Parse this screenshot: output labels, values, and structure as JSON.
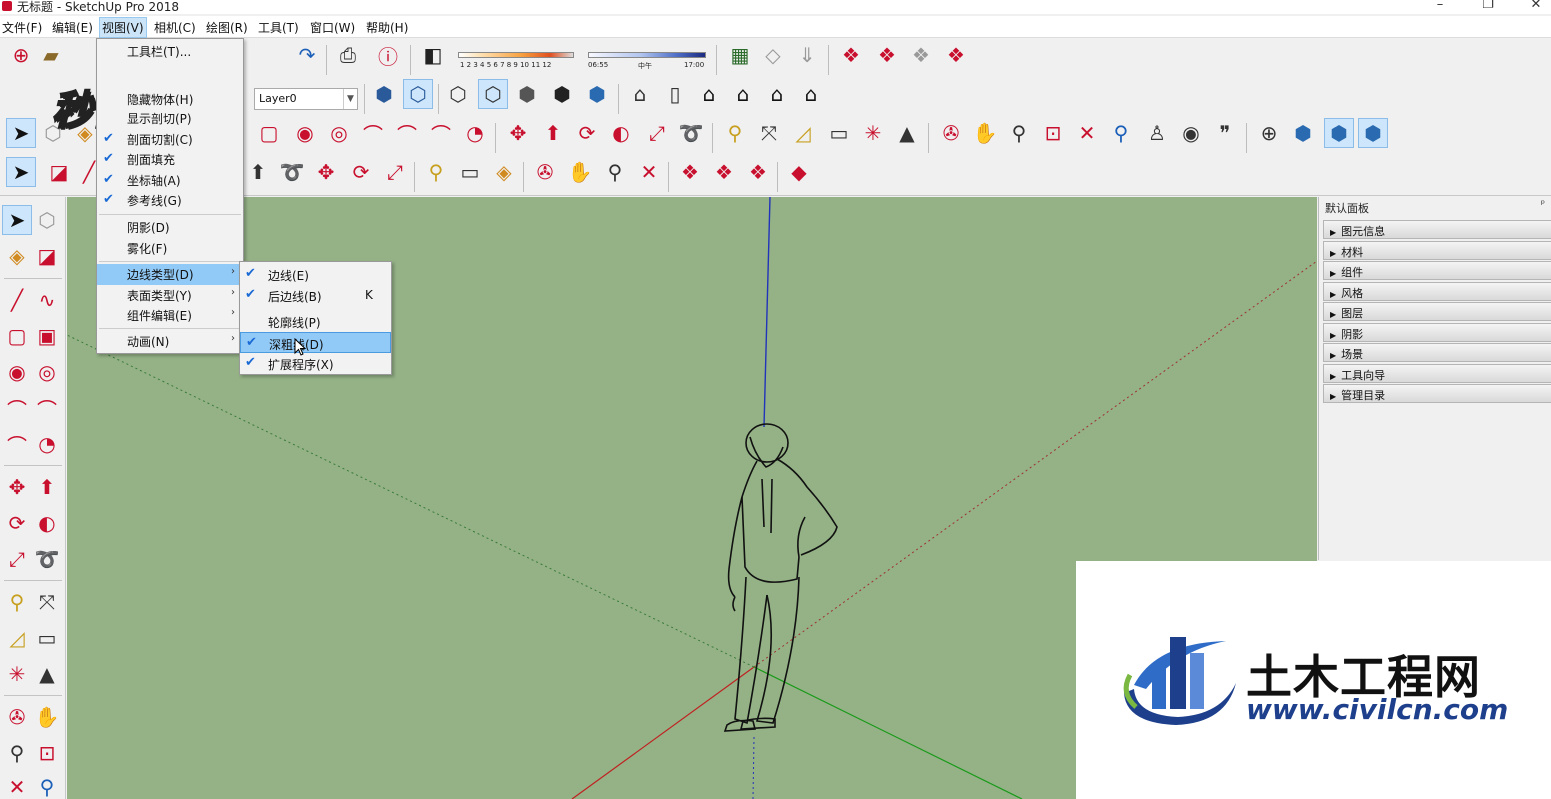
{
  "window": {
    "title": "无标题 - SketchUp Pro 2018",
    "minimize": "–",
    "restore": "❐",
    "close": "✕"
  },
  "menubar": {
    "items": [
      "文件(F)",
      "编辑(E)",
      "视图(V)",
      "相机(C)",
      "绘图(R)",
      "工具(T)",
      "窗口(W)",
      "帮助(H)"
    ],
    "active": "视图(V)"
  },
  "watermark_top": "秒懂视频",
  "toolbar": {
    "layer_value": "Layer0",
    "shadow_ticks": "1 2 3 4 5 6 7 8 9 10 11 12",
    "time_start": "06:55",
    "time_mid": "中午",
    "time_end": "17:00"
  },
  "view_menu": {
    "items": [
      {
        "label": "工具栏(T)...",
        "checked": false
      },
      {
        "label": "隐藏物体(H)",
        "checked": false
      },
      {
        "label": "显示剖切(P)",
        "checked": false
      },
      {
        "label": "剖面切割(C)",
        "checked": true
      },
      {
        "label": "剖面填充",
        "checked": true
      },
      {
        "label": "坐标轴(A)",
        "checked": true
      },
      {
        "label": "参考线(G)",
        "checked": true
      },
      {
        "label": "阴影(D)",
        "checked": false
      },
      {
        "label": "雾化(F)",
        "checked": false
      },
      {
        "label": "边线类型(D)",
        "checked": false,
        "submenu": true,
        "highlighted": true
      },
      {
        "label": "表面类型(Y)",
        "checked": false,
        "submenu": true
      },
      {
        "label": "组件编辑(E)",
        "checked": false,
        "submenu": true
      },
      {
        "label": "动画(N)",
        "checked": false,
        "submenu": true
      }
    ]
  },
  "edge_submenu": {
    "items": [
      {
        "label": "边线(E)",
        "checked": true,
        "shortcut": ""
      },
      {
        "label": "后边线(B)",
        "checked": true,
        "shortcut": "K"
      },
      {
        "label": "轮廓线(P)",
        "checked": false,
        "shortcut": ""
      },
      {
        "label": "深粗线(D)",
        "checked": true,
        "shortcut": "",
        "highlighted": true
      },
      {
        "label": "扩展程序(X)",
        "checked": true,
        "shortcut": ""
      }
    ]
  },
  "tray": {
    "title": "默认面板",
    "pin": "ᵖ",
    "items": [
      "图元信息",
      "材料",
      "组件",
      "风格",
      "图层",
      "阴影",
      "场景",
      "工具向导",
      "管理目录"
    ]
  },
  "logo": {
    "name": "土木工程网",
    "url": "www.civilcn.com"
  },
  "colors": {
    "viewport": "#94b286",
    "menu_highlight": "#91c9f7",
    "axis_blue": "#2233bb",
    "axis_red": "#c02020",
    "axis_green": "#1a9a1a",
    "logo_blue": "#1d3f8c"
  }
}
